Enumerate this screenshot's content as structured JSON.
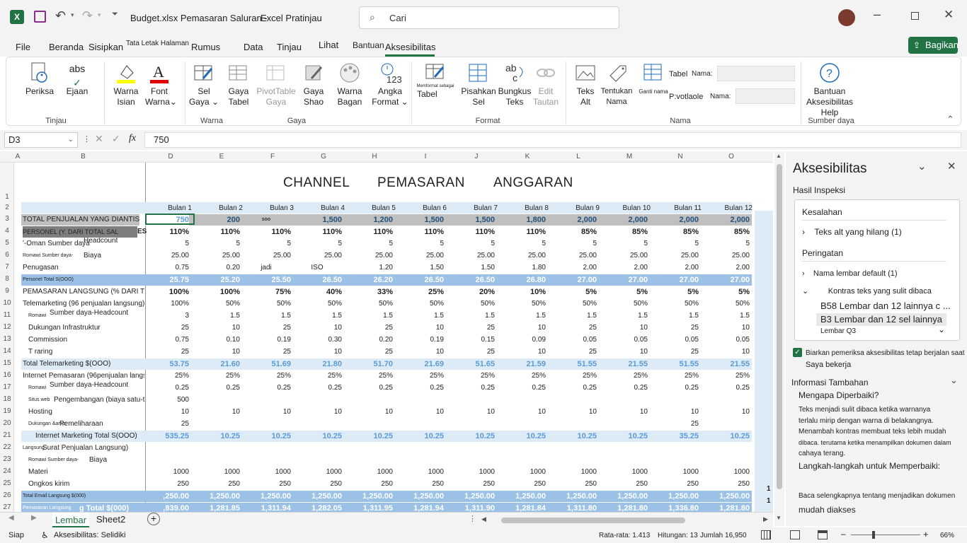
{
  "title": {
    "file": "Budget.xlsx Pemasaran Saluran -",
    "app": "Excel Pratinjau",
    "search_placeholder": "Cari"
  },
  "tabs": [
    "File",
    "Beranda",
    "Sisipkan",
    "Tata Letak Halaman",
    "Rumus",
    "Data",
    "Tinjau",
    "Lihat",
    "Bantuan",
    "Aksesibilitas"
  ],
  "share": "Bagikan",
  "ribbon": {
    "periksa": "Periksa",
    "ejaan": "Ejaan",
    "tinjau": "Tinjau",
    "warna_isian": [
      "Warna",
      "Isian"
    ],
    "font_warna": [
      "Font",
      "Warna"
    ],
    "sel_gaya": [
      "Sel",
      "Gaya"
    ],
    "gaya_tabel": [
      "Gaya",
      "Tabel"
    ],
    "pivot_gaya": [
      "PivotTable",
      "Gaya"
    ],
    "gaya_shao": [
      "Gaya",
      "Shao"
    ],
    "warna_bagan": [
      "Warna",
      "Bagan"
    ],
    "angka_format": [
      "Angka",
      "Format"
    ],
    "grp_warna": "Warna",
    "grp_gaya": "Gaya",
    "memformat": "Memformat sebagai",
    "memformat_tabel": "Tabel",
    "pisahkan": [
      "Pisahkan",
      "Sel"
    ],
    "bungkus": [
      "Bungkus",
      "Teks"
    ],
    "edit_tautan": [
      "Edit",
      "Tautan"
    ],
    "grp_format": "Format",
    "teks_alt": [
      "Teks",
      "Alt"
    ],
    "tentukan_nama": [
      "Tentukan",
      "Nama"
    ],
    "ganti_nama": "Ganti nama",
    "tabel_nama": "Tabel",
    "nama1": "Nama:",
    "pivotable": "P:votlaole",
    "nama2": "Nama:",
    "grp_nama": "Nama",
    "bantuan": [
      "Bantuan Aksesibilitas",
      "Help"
    ],
    "grp_sumber": "Sumber daya",
    "abs": "abs",
    "angka_icon_text": "123"
  },
  "formula": {
    "namebox": "D3",
    "value": "750",
    "fx": "fx"
  },
  "columns": [
    "A",
    "B",
    "D",
    "E",
    "F",
    "G",
    "H",
    "I",
    "J",
    "K",
    "L",
    "M",
    "N",
    "O"
  ],
  "sheet_title": [
    "CHANNEL",
    "PEMASARAN",
    "ANGGARAN"
  ],
  "month_headers": [
    "Bulan 1",
    "Bulan 2",
    "Bulan 3",
    "Bulan 4",
    "Bulan 5",
    "Bulan 6",
    "Bulan 7",
    "Bulan 8",
    "Bulan 9",
    "Bulan 10",
    "Bulan 11",
    "Bulan 12"
  ],
  "row_numbers": [
    "1",
    "2",
    "3",
    "4",
    "5",
    "6",
    "7",
    "8",
    "9",
    "10",
    "11",
    "12",
    "13",
    "14",
    "15",
    "16",
    "17",
    "18",
    "19",
    "20",
    "21",
    "22",
    "23",
    "24",
    "25",
    "26",
    "27"
  ],
  "rows": [
    {
      "r": 3,
      "label": "TOTAL PENJUALAN YANG DIANTISIPASI",
      "values": [
        "750",
        "200",
        "soo",
        "1,500",
        "1,200",
        "1,500",
        "1,500",
        "1,800",
        "2,000",
        "2,000",
        "2,000",
        "2,000"
      ]
    },
    {
      "r": 4,
      "label": "PERSONEL (Y. DARI TOTAL SAL",
      "extra": "ES",
      "values": [
        "110%",
        "110%",
        "110%",
        "110%",
        "110%",
        "110%",
        "110%",
        "110%",
        "85%",
        "85%",
        "85%",
        "85%"
      ]
    },
    {
      "r": 5,
      "label": "'-Oman Sumber daya",
      "sub": "Headcount",
      "values": [
        "5",
        "5",
        "5",
        "5",
        "5",
        "5",
        "5",
        "5",
        "5",
        "5",
        "5",
        "5"
      ]
    },
    {
      "r": 6,
      "label": "Romawi  Sumber daya-",
      "sub": "Biaya",
      "values": [
        "25.00",
        "25.00",
        "25.00",
        "25.00",
        "25.00",
        "25.00",
        "25.00",
        "25.00",
        "25.00",
        "25.00",
        "25.00",
        "25.00"
      ]
    },
    {
      "r": 7,
      "label": "Penugasan",
      "values": [
        "0.75",
        "0.20",
        "jadi",
        "ISO",
        "1.20",
        "1.50",
        "1.50",
        "1.80",
        "2.00",
        "2.00",
        "2.00",
        "2.00"
      ]
    },
    {
      "r": 8,
      "label": "Personel Total S(OOO)",
      "values": [
        "25.75",
        "25.20",
        "25.50",
        "26.50",
        "26.20",
        "26.50",
        "26.50",
        "26.80",
        "27.00",
        "27.00",
        "27.00",
        "27.00"
      ]
    },
    {
      "r": 9,
      "label": "PEMASARAN LANGSUNG (% DARI TOTAL",
      "values": [
        "100%",
        "100%",
        "75%",
        "40%",
        "33%",
        "25%",
        "20%",
        "10%",
        "5%",
        "5%",
        "5%",
        "5%"
      ]
    },
    {
      "r": 10,
      "label": "Telemarketing (96 penjualan langsung)",
      "values": [
        "100%",
        "50%",
        "50%",
        "50%",
        "50%",
        "50%",
        "50%",
        "50%",
        "50%",
        "50%",
        "50%",
        "50%"
      ]
    },
    {
      "r": 11,
      "label": "Romawi",
      "sub": "Sumber daya-Headcount",
      "values": [
        "3",
        "1.5",
        "1.5",
        "1.5",
        "1.5",
        "1.5",
        "1.5",
        "1.5",
        "1.5",
        "1.5",
        "1.5",
        "1.5"
      ]
    },
    {
      "r": 12,
      "label": "Dukungan Infrastruktur",
      "values": [
        "25",
        "10",
        "25",
        "10",
        "25",
        "10",
        "25",
        "10",
        "25",
        "10",
        "25",
        "10"
      ]
    },
    {
      "r": 13,
      "label": "Commission",
      "values": [
        "0.75",
        "0.10",
        "0.19",
        "0.30",
        "0.20",
        "0.19",
        "0.15",
        "0.09",
        "0.05",
        "0.05",
        "0.05",
        "0.05"
      ]
    },
    {
      "r": 14,
      "label": "T raring",
      "values": [
        "25",
        "10",
        "25",
        "10",
        "25",
        "10",
        "25",
        "10",
        "25",
        "10",
        "25",
        "10"
      ]
    },
    {
      "r": 15,
      "label": "Total Telemarketing $(OOO)",
      "values": [
        "53.75",
        "21.60",
        "51.69",
        "21.80",
        "51.70",
        "21.69",
        "51.65",
        "21.59",
        "51.55",
        "21.55",
        "51.55",
        "21.55"
      ]
    },
    {
      "r": 16,
      "label": "Internet  Pemasaran (96penjualan langsung)",
      "values": [
        "25%",
        "25%",
        "25%",
        "25%",
        "25%",
        "25%",
        "25%",
        "25%",
        "25%",
        "25%",
        "25%",
        "25%"
      ]
    },
    {
      "r": 17,
      "label": "Romawi",
      "sub": "Sumber daya-Headcount",
      "values": [
        "0.25",
        "0.25",
        "0.25",
        "0.25",
        "0.25",
        "0.25",
        "0.25",
        "0.25",
        "0.25",
        "0.25",
        "0.25",
        "0.25"
      ]
    },
    {
      "r": 18,
      "label": "Situs web",
      "sub": "Pengembangan (biaya satu-tim)",
      "values": [
        "500",
        "",
        "",
        "",
        "",
        "",
        "",
        "",
        "",
        "",
        "",
        ""
      ]
    },
    {
      "r": 19,
      "label": "Hosting",
      "values": [
        "10",
        "10",
        "10",
        "10",
        "10",
        "10",
        "10",
        "10",
        "10",
        "10",
        "10",
        "10"
      ]
    },
    {
      "r": 20,
      "label": "Dukungan &amp;",
      "sub": "Pemeliharaan",
      "values": [
        "25",
        "",
        "",
        "",
        "",
        "",
        "",
        "",
        "",
        "",
        "25",
        ""
      ]
    },
    {
      "r": 21,
      "label": "Internet Marketing Total S(OOO)",
      "values": [
        "535.25",
        "10.25",
        "10.25",
        "10.25",
        "10.25",
        "10.25",
        "10.25",
        "10.25",
        "10.25",
        "10.25",
        "35.25",
        "10.25"
      ]
    },
    {
      "r": 22,
      "label": "Langsung",
      "sub": "Surat Penjualan Langsung)",
      "values": [
        "",
        "",
        "",
        "",
        "",
        "",
        "",
        "",
        "",
        "",
        "",
        ""
      ]
    },
    {
      "r": 23,
      "label": "Romawi  Sumber daya-",
      "sub": "Biaya",
      "values": [
        "",
        "",
        "",
        "",
        "",
        "",
        "",
        "",
        "",
        "",
        "",
        ""
      ]
    },
    {
      "r": 24,
      "label": "Materi",
      "values": [
        "1000",
        "1000",
        "1000",
        "1000",
        "1000",
        "1000",
        "1000",
        "1000",
        "1000",
        "1000",
        "1000",
        "1000"
      ]
    },
    {
      "r": 25,
      "label": "Ongkos kirim",
      "values": [
        "250",
        "250",
        "250",
        "250",
        "250",
        "250",
        "250",
        "250",
        "250",
        "250",
        "250",
        "250"
      ]
    },
    {
      "r": 26,
      "label": "Total Email Langsung $(000)",
      "values": [
        ",250.00",
        "1,250.00",
        "1,250.00",
        "1,250.00",
        "1,250.00",
        "1,250.00",
        "1,250.00",
        "1,250.00",
        "1,250.00",
        "1,250.00",
        "1,250.00",
        "1,250.00"
      ]
    },
    {
      "r": 27,
      "label": "Pemasaran Langsung",
      "sub": "g Total $(000)",
      "values": [
        ",839.00",
        "1,281.85",
        "1,311.94",
        "1,282.05",
        "1,311.95",
        "1,281.94",
        "1,311.90",
        "1,281.84",
        "1,311.80",
        "1,281.80",
        "1,336.80",
        "1,281.80"
      ]
    }
  ],
  "sheet_tabs": [
    "Lembar",
    "Sheet2"
  ],
  "pane": {
    "title": "Aksesibilitas",
    "results": "Hasil Inspeksi",
    "errors": "Kesalahan",
    "err1": "Teks alt yang hilang (1)",
    "warnings": "Peringatan",
    "warn1": "Nama lembar default (1)",
    "warn2": "Kontras teks yang sulit dibaca",
    "sub1": "B58 Lembar dan 12 lainnya c ...",
    "sub2": "B3 Lembar dan 12 sel lainnya",
    "sub3": "Lembar Q3",
    "keep": "Biarkan pemeriksa aksesibilitas tetap berjalan saat",
    "keep2": "Saya bekerja",
    "info": "Informasi Tambahan",
    "why": "Mengapa Diperbaiki?",
    "why_text": [
      "Teks menjadi sulit dibaca ketika warnanya",
      "terlalu mirip dengan warna di belakangnya.",
      "Menambah kontras membuat teks lebih mudah",
      "dibaca. terutama ketika menampilkan dokumen dalam",
      "cahaya terang."
    ],
    "steps": "Langkah-langkah untuk Memperbaiki:",
    "more": "Baca selengkapnya tentang menjadikan dokumen",
    "more2": "mudah diakses"
  },
  "status": {
    "ready": "Siap",
    "acc": "Aksesibilitas: Selidiki",
    "avg": "Rata-rata: 1.413",
    "count": "Hitungan: 13",
    "sum": "Jumlah 16,950",
    "zoom": "66%"
  },
  "colors": {
    "accent": "#217346",
    "header_blue": "#9bc2e6",
    "light_blue": "#ddebf7",
    "grey_row": "#bfbfbf"
  }
}
